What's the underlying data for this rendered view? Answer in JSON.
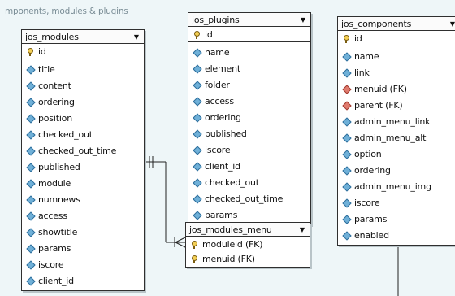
{
  "caption": "mponents, modules & plugins",
  "tables": {
    "modules": {
      "name": "jos_modules",
      "pk": {
        "label": "id",
        "icon": "key-icon"
      },
      "columns": [
        {
          "label": "title",
          "icon": "diamond-icon"
        },
        {
          "label": "content",
          "icon": "diamond-icon"
        },
        {
          "label": "ordering",
          "icon": "diamond-icon"
        },
        {
          "label": "position",
          "icon": "diamond-icon"
        },
        {
          "label": "checked_out",
          "icon": "diamond-icon"
        },
        {
          "label": "checked_out_time",
          "icon": "diamond-icon"
        },
        {
          "label": "published",
          "icon": "diamond-icon"
        },
        {
          "label": "module",
          "icon": "diamond-icon"
        },
        {
          "label": "numnews",
          "icon": "diamond-icon"
        },
        {
          "label": "access",
          "icon": "diamond-icon"
        },
        {
          "label": "showtitle",
          "icon": "diamond-icon"
        },
        {
          "label": "params",
          "icon": "diamond-icon"
        },
        {
          "label": "iscore",
          "icon": "diamond-icon"
        },
        {
          "label": "client_id",
          "icon": "diamond-icon"
        }
      ]
    },
    "plugins": {
      "name": "jos_plugins",
      "pk": {
        "label": "id",
        "icon": "key-icon"
      },
      "columns": [
        {
          "label": "name",
          "icon": "diamond-icon"
        },
        {
          "label": "element",
          "icon": "diamond-icon"
        },
        {
          "label": "folder",
          "icon": "diamond-icon"
        },
        {
          "label": "access",
          "icon": "diamond-icon"
        },
        {
          "label": "ordering",
          "icon": "diamond-icon"
        },
        {
          "label": "published",
          "icon": "diamond-icon"
        },
        {
          "label": "iscore",
          "icon": "diamond-icon"
        },
        {
          "label": "client_id",
          "icon": "diamond-icon"
        },
        {
          "label": "checked_out",
          "icon": "diamond-icon"
        },
        {
          "label": "checked_out_time",
          "icon": "diamond-icon"
        },
        {
          "label": "params",
          "icon": "diamond-icon"
        }
      ]
    },
    "components": {
      "name": "jos_components",
      "pk": {
        "label": "id",
        "icon": "key-icon"
      },
      "columns": [
        {
          "label": "name",
          "icon": "diamond-icon"
        },
        {
          "label": "link",
          "icon": "diamond-icon"
        },
        {
          "label": "menuid (FK)",
          "icon": "fk-icon"
        },
        {
          "label": "parent (FK)",
          "icon": "fk-icon"
        },
        {
          "label": "admin_menu_link",
          "icon": "diamond-icon"
        },
        {
          "label": "admin_menu_alt",
          "icon": "diamond-icon"
        },
        {
          "label": "option",
          "icon": "diamond-icon"
        },
        {
          "label": "ordering",
          "icon": "diamond-icon"
        },
        {
          "label": "admin_menu_img",
          "icon": "diamond-icon"
        },
        {
          "label": "iscore",
          "icon": "diamond-icon"
        },
        {
          "label": "params",
          "icon": "diamond-icon"
        },
        {
          "label": "enabled",
          "icon": "diamond-icon"
        }
      ]
    },
    "modules_menu": {
      "name": "jos_modules_menu",
      "keys": [
        {
          "label": "moduleid (FK)",
          "icon": "key-icon"
        },
        {
          "label": "menuid (FK)",
          "icon": "key-icon"
        }
      ]
    }
  },
  "dropdown_glyph": "▼"
}
